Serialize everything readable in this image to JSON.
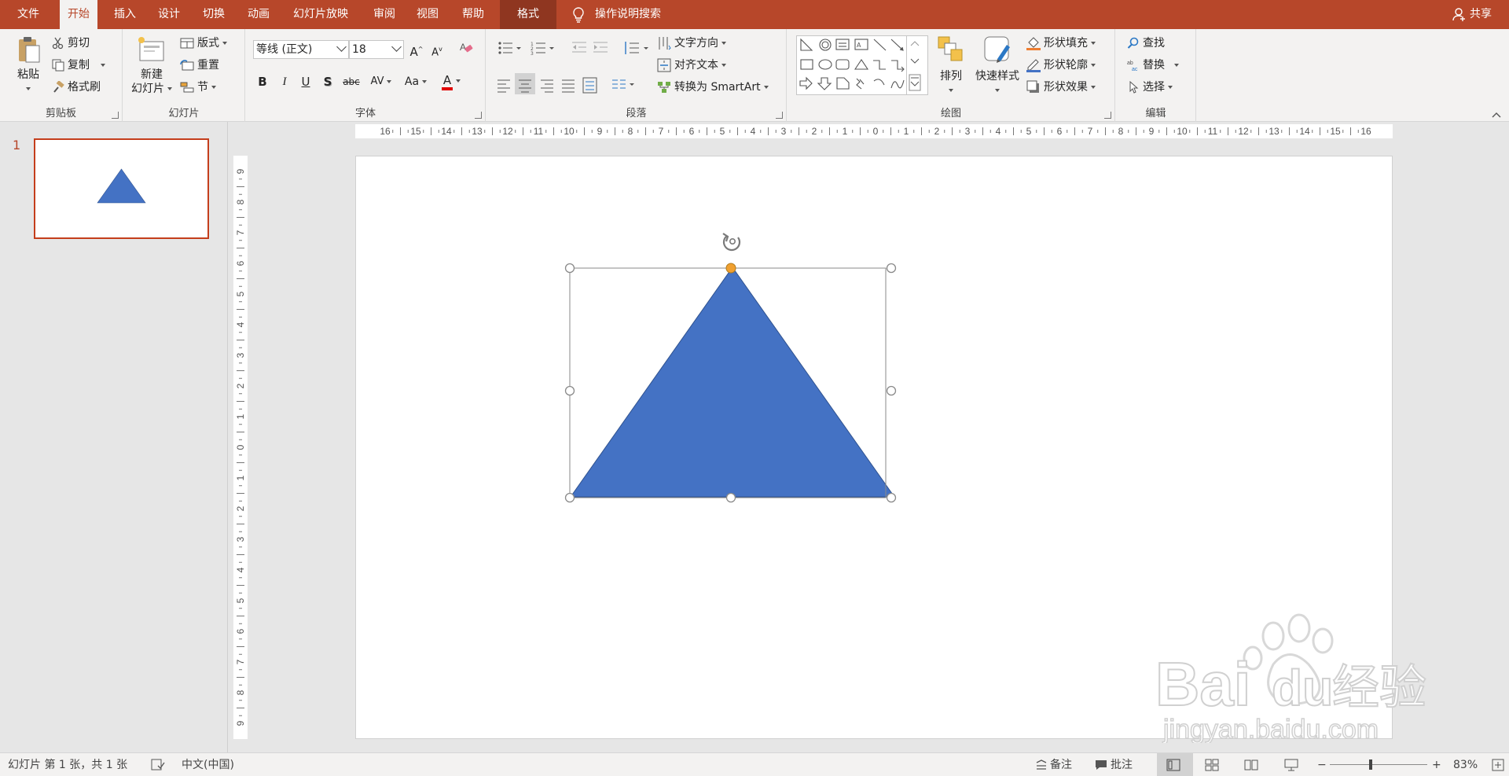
{
  "tabs": {
    "file": "文件",
    "home": "开始",
    "insert": "插入",
    "design": "设计",
    "transitions": "切换",
    "animations": "动画",
    "slideshow": "幻灯片放映",
    "review": "审阅",
    "view": "视图",
    "help": "帮助",
    "format": "格式"
  },
  "tell_me": "操作说明搜索",
  "share": "共享",
  "clipboard": {
    "paste": "粘贴",
    "cut": "剪切",
    "copy": "复制",
    "format_painter": "格式刷",
    "label": "剪贴板"
  },
  "slides_group": {
    "new_slide_line1": "新建",
    "new_slide_line2": "幻灯片",
    "layout": "版式",
    "reset": "重置",
    "section": "节",
    "label": "幻灯片"
  },
  "font": {
    "name": "等线 (正文)",
    "size": "18",
    "grow": "A",
    "shrink": "A",
    "bold": "B",
    "italic": "I",
    "underline": "U",
    "shadow": "S",
    "strike": "abc",
    "spacing": "AV",
    "case": "Aa",
    "color": "A",
    "label": "字体"
  },
  "paragraph": {
    "text_direction": "文字方向",
    "align_text": "对齐文本",
    "smartart": "转换为 SmartArt",
    "label": "段落"
  },
  "drawing": {
    "arrange": "排列",
    "quick_styles": "快速样式",
    "shape_fill": "形状填充",
    "shape_outline": "形状轮廓",
    "shape_effects": "形状效果",
    "label": "绘图"
  },
  "editing": {
    "find": "查找",
    "replace": "替换",
    "select": "选择",
    "label": "编辑"
  },
  "thumbnails": {
    "slide_number": "1"
  },
  "ruler": {
    "h_labels": [
      "16",
      "15",
      "14",
      "13",
      "12",
      "11",
      "10",
      "9",
      "8",
      "7",
      "6",
      "5",
      "4",
      "3",
      "2",
      "1",
      "0",
      "1",
      "2",
      "3",
      "4",
      "5",
      "6",
      "7",
      "8",
      "9",
      "10",
      "11",
      "12",
      "13",
      "14",
      "15",
      "16"
    ],
    "v_labels": [
      "9",
      "8",
      "7",
      "6",
      "5",
      "4",
      "3",
      "2",
      "1",
      "0",
      "1",
      "2",
      "3",
      "4",
      "5",
      "6",
      "7",
      "8",
      "9"
    ]
  },
  "status": {
    "slide_info": "幻灯片 第 1 张，共 1 张",
    "language": "中文(中国)",
    "notes": "备注",
    "comments": "批注",
    "zoom": "83%"
  },
  "colors": {
    "accent": "#b7472a",
    "shape_fill": "#4472c4",
    "shape_outline": "#2f528f",
    "adjust_handle": "#f0a030"
  },
  "watermark": {
    "brand": "Bai",
    "brand2": "du",
    "cn": "经验",
    "url": "jingyan.baidu.com"
  }
}
